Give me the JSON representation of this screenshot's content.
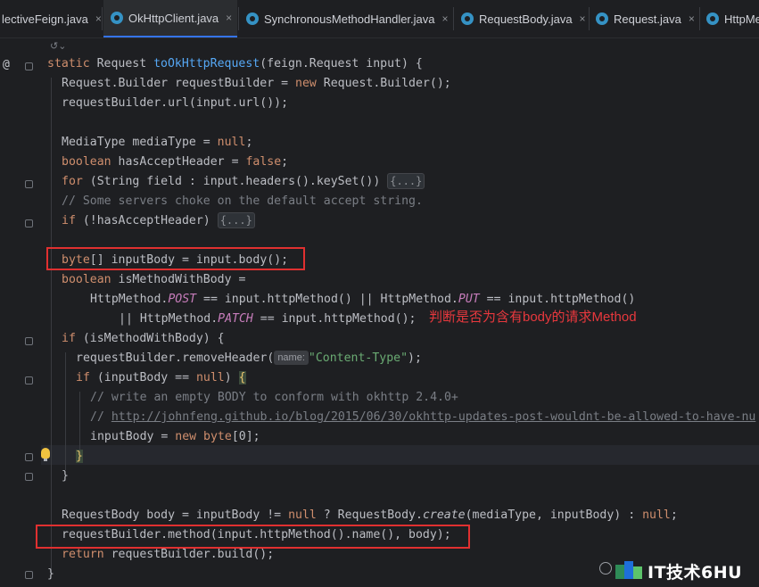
{
  "tabs": [
    {
      "label": "lectiveFeign.java",
      "active": false
    },
    {
      "label": "OkHttpClient.java",
      "active": true
    },
    {
      "label": "SynchronousMethodHandler.java",
      "active": false
    },
    {
      "label": "RequestBody.java",
      "active": false
    },
    {
      "label": "Request.java",
      "active": false
    },
    {
      "label": "HttpMe",
      "active": false
    }
  ],
  "tab_close_glyph": "×",
  "gutter": {
    "override_marker": "@",
    "icon_name_top": "inlay-hints-toggle-icon",
    "bulb_icon": "lightbulb-icon"
  },
  "code": {
    "l1_kw": "static ",
    "l1_type": "Request ",
    "l1_fn": "toOkHttpRequest",
    "l1_rest": "(feign.Request input) {",
    "l2_a": "Request.Builder requestBuilder = ",
    "l2_kw": "new ",
    "l2_b": "Request.Builder();",
    "l3": "requestBuilder.url(input.url());",
    "l4_a": "MediaType mediaType = ",
    "l4_kw": "null",
    "l4_b": ";",
    "l5_kw": "boolean ",
    "l5_a": "hasAcceptHeader = ",
    "l5_kw2": "false",
    "l5_b": ";",
    "l6_kw": "for ",
    "l6_a": "(String field : input.headers().keySet()) ",
    "l6_fold": "{...}",
    "l7": "// Some servers choke on the default accept string.",
    "l8_kw": "if ",
    "l8_a": "(!hasAcceptHeader) ",
    "l8_fold": "{...}",
    "l9_kw": "byte",
    "l9_a": "[] inputBody = input.body();",
    "l10_kw": "boolean ",
    "l10_a": "isMethodWithBody =",
    "l11_a": "HttpMethod.",
    "l11_c1": "POST",
    "l11_b": " == input.httpMethod() || HttpMethod.",
    "l11_c2": "PUT",
    "l11_c": " == input.httpMethod()",
    "l12_a": "|| HttpMethod.",
    "l12_c": "PATCH",
    "l12_b": " == input.httpMethod();",
    "l13_kw": "if ",
    "l13_a": "(isMethodWithBody) {",
    "l14_a": "requestBuilder.removeHeader(",
    "l14_hint": "name:",
    "l14_str": "\"Content-Type\"",
    "l14_b": ");",
    "l15_kw": "if ",
    "l15_a": "(inputBody == ",
    "l15_kw2": "null",
    "l15_b": ") ",
    "l15_brace": "{",
    "l16": "// write an empty BODY to conform with okhttp 2.4.0+",
    "l17_a": "// ",
    "l17_link": "http://johnfeng.github.io/blog/2015/06/30/okhttp-updates-post-wouldnt-be-allowed-to-have-nu",
    "l18_a": "inputBody = ",
    "l18_kw": "new byte",
    "l18_b": "[0];",
    "l19": "}",
    "l20": "}",
    "l21_a": "RequestBody body = inputBody != ",
    "l21_kw": "null",
    "l21_b": " ? RequestBody.",
    "l21_it": "create",
    "l21_c": "(mediaType, inputBody) : ",
    "l21_kw2": "null",
    "l21_d": ";",
    "l22": "requestBuilder.method(input.httpMethod().name(), body);",
    "l23_kw": "return ",
    "l23_a": "requestBuilder.build();",
    "l24": "}"
  },
  "annotation": {
    "text": "判断是否为含有body的请求Method",
    "color": "#e8383d"
  },
  "watermark": {
    "text": "IT技术6HU"
  },
  "colors": {
    "keyword": "#cf8e6d",
    "function": "#56a8f5",
    "string": "#6aab73",
    "comment": "#7a7e85",
    "constant": "#c77dbb",
    "annotation_box": "#e03030",
    "active_tab_underline": "#3574f0"
  }
}
